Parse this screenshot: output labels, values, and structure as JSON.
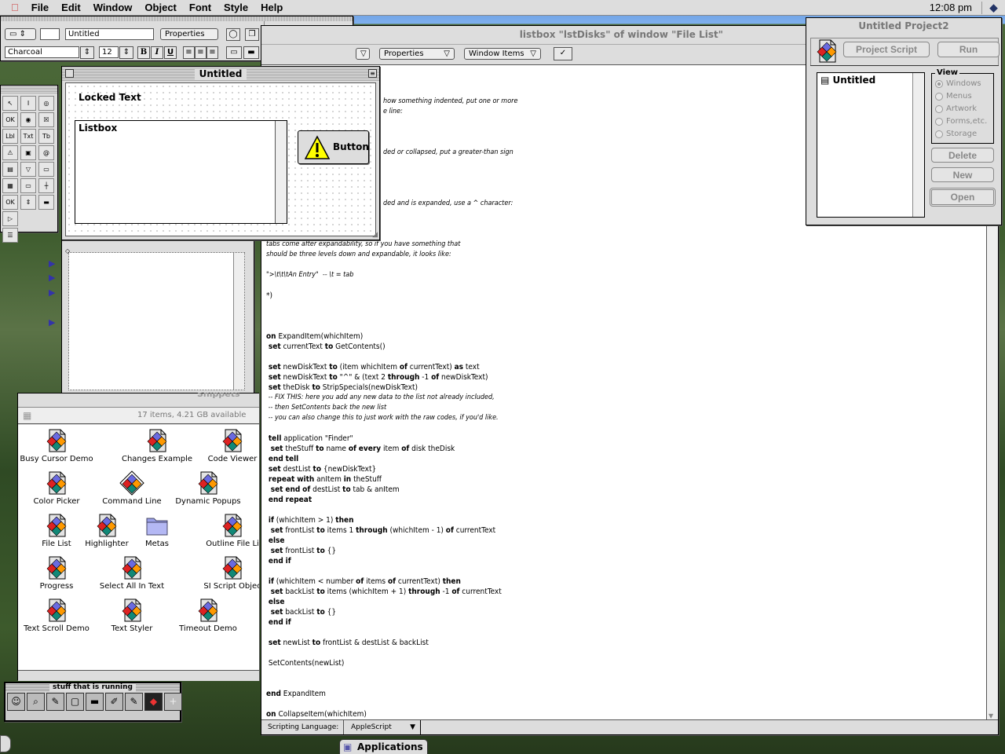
{
  "menubar": {
    "items": [
      "File",
      "Edit",
      "Window",
      "Object",
      "Font",
      "Style",
      "Help"
    ],
    "clock": "12:08 pm"
  },
  "props_toolbar": {
    "name_value": "Untitled",
    "properties_label": "Properties",
    "font_value": "Charcoal",
    "size_value": "12",
    "bold": "B",
    "italic": "I",
    "underline": "U",
    "left": "82",
    "top": "104",
    "width": "398",
    "height": "200"
  },
  "script_window": {
    "title": "listbox \"lstDisks\" of window \"File List\"",
    "properties_popup": "Properties",
    "window_items_popup": "Window Items",
    "check_icon": "checkmark-icon",
    "status_label": "Scripting Language:",
    "language": "AppleScript",
    "lines": [
      {
        "t": "how something indented, put one or more",
        "c": 1,
        "clip": 1
      },
      {
        "t": "e line:",
        "c": 1,
        "clip": 1
      },
      {
        "t": ""
      },
      {
        "t": ""
      },
      {
        "t": ""
      },
      {
        "t": "ded or collapsed, put a greater-than sign",
        "c": 1,
        "clip": 1
      },
      {
        "t": ""
      },
      {
        "t": ""
      },
      {
        "t": ""
      },
      {
        "t": ""
      },
      {
        "t": "ded and is expanded, use a ^ character:",
        "c": 1,
        "clip": 1
      },
      {
        "t": ""
      },
      {
        "t": ""
      },
      {
        "t": ""
      },
      {
        "t": "tabs come after expandability, so if you have something that",
        "c": 1
      },
      {
        "t": "should be three levels down and expandable, it looks like:",
        "c": 1
      },
      {
        "t": ""
      },
      {
        "t": "\">\\t\\t\\tAn Entry\"  -- \\t = tab",
        "c": 1
      },
      {
        "t": ""
      },
      {
        "t": "*)"
      },
      {
        "t": ""
      },
      {
        "t": ""
      },
      {
        "t": ""
      },
      {
        "t": "on ExpandItem(whichItem)"
      },
      {
        "t": " set currentText to GetContents()"
      },
      {
        "t": ""
      },
      {
        "t": " set newDiskText to (item whichItem of currentText) as text"
      },
      {
        "t": " set newDiskText to \"^\" & (text 2 through -1 of newDiskText)"
      },
      {
        "t": " set theDisk to StripSpecials(newDiskText)"
      },
      {
        "t": " -- FIX THIS: here you add any new data to the list not already included,",
        "c": 1
      },
      {
        "t": " -- then SetContents back the new list",
        "c": 1
      },
      {
        "t": " -- you can also change this to just work with the raw codes, if you'd like.",
        "c": 1
      },
      {
        "t": ""
      },
      {
        "t": " tell application \"Finder\""
      },
      {
        "t": "  set theStuff to name of every item of disk theDisk"
      },
      {
        "t": " end tell"
      },
      {
        "t": " set destList to {newDiskText}"
      },
      {
        "t": " repeat with anItem in theStuff"
      },
      {
        "t": "  set end of destList to tab & anItem"
      },
      {
        "t": " end repeat"
      },
      {
        "t": ""
      },
      {
        "t": " if (whichItem > 1) then"
      },
      {
        "t": "  set frontList to items 1 through (whichItem - 1) of currentText"
      },
      {
        "t": " else"
      },
      {
        "t": "  set frontList to {}"
      },
      {
        "t": " end if"
      },
      {
        "t": ""
      },
      {
        "t": " if (whichItem < number of items of currentText) then"
      },
      {
        "t": "  set backList to items (whichItem + 1) through -1 of currentText"
      },
      {
        "t": " else"
      },
      {
        "t": "  set backList to {}"
      },
      {
        "t": " end if"
      },
      {
        "t": ""
      },
      {
        "t": " set newList to frontList & destList & backList"
      },
      {
        "t": ""
      },
      {
        "t": " SetContents(newList)"
      },
      {
        "t": ""
      },
      {
        "t": ""
      },
      {
        "t": "end ExpandItem"
      },
      {
        "t": ""
      },
      {
        "t": "on CollapseItem(whichItem)"
      }
    ]
  },
  "layout_window": {
    "title": "Untitled",
    "locked_text": "Locked Text",
    "listbox_label": "Listbox",
    "button_label": "Button"
  },
  "project_window": {
    "title": "Untitled Project2",
    "project_script": "Project Script",
    "run": "Run",
    "list_item": "Untitled",
    "view_label": "View",
    "view_options": [
      "Windows",
      "Menus",
      "Artwork",
      "Forms,etc.",
      "Storage"
    ],
    "selected_view": "Windows",
    "delete": "Delete",
    "new": "New",
    "open": "Open"
  },
  "finder": {
    "partial_title": "Snippets",
    "status": "17 items, 4.21 GB available",
    "items": [
      {
        "label": "Busy Cursor Demo",
        "kind": "script"
      },
      {
        "label": "Changes Example",
        "kind": "script"
      },
      {
        "label": "Code Viewer",
        "kind": "script"
      },
      {
        "label": "Color Picker",
        "kind": "script"
      },
      {
        "label": "Command Line",
        "kind": "app"
      },
      {
        "label": "Dynamic Popups",
        "kind": "script"
      },
      {
        "label": "File List",
        "kind": "script"
      },
      {
        "label": "Highlighter",
        "kind": "script"
      },
      {
        "label": "Metas",
        "kind": "folder"
      },
      {
        "label": "Outline File Li",
        "kind": "script"
      },
      {
        "label": "Progress",
        "kind": "script"
      },
      {
        "label": "Select All In Text",
        "kind": "script"
      },
      {
        "label": "SI Script Objec",
        "kind": "script"
      },
      {
        "label": "Text Scroll Demo",
        "kind": "script"
      },
      {
        "label": "Text Styler",
        "kind": "script"
      },
      {
        "label": "Timeout Demo",
        "kind": "script"
      }
    ]
  },
  "running_palette": {
    "title": "stuff that is running"
  },
  "app_tab": {
    "label": "Applications"
  },
  "colors": {
    "desktop_green": "#3f5d2f",
    "platinum": "#dddddd",
    "sky": "#6fa3e6"
  }
}
